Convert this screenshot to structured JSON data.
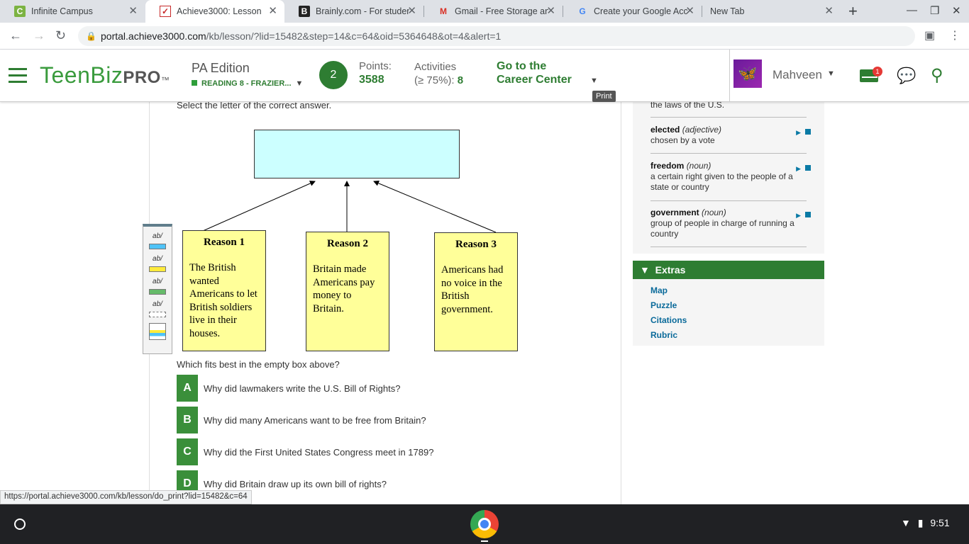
{
  "browser": {
    "tabs": [
      {
        "label": "Infinite Campus",
        "icon": "infinite-campus-icon"
      },
      {
        "label": "Achieve3000: Lesson",
        "icon": "achieve3000-icon"
      },
      {
        "label": "Brainly.com - For studen",
        "icon": "brainly-icon"
      },
      {
        "label": "Gmail - Free Storage and",
        "icon": "gmail-icon"
      },
      {
        "label": "Create your Google Acco",
        "icon": "google-icon"
      },
      {
        "label": "New Tab",
        "icon": ""
      }
    ],
    "url_host": "portal.achieve3000.com",
    "url_path": "/kb/lesson/?lid=15482&step=14&c=64&oid=5364648&ot=4&alert=1"
  },
  "header": {
    "logo_text": "TeenBiz",
    "logo_pro": "PRO",
    "logo_tm": "™",
    "edition": "PA Edition",
    "class_label": "READING 8 - FRAZIER...",
    "level": "2",
    "points_label": "Points:",
    "points_value": "3588",
    "activities_label_1": "Activities",
    "activities_label_2": "(≥ 75%):",
    "activities_value": "8",
    "career_1": "Go to the",
    "career_2": "Career Center",
    "username": "Mahveen",
    "mail_badge": "1",
    "print_tooltip": "Print"
  },
  "lesson": {
    "prompt": "Select the letter of the correct answer.",
    "reasons": [
      {
        "title": "Reason 1",
        "text": "The British wanted Americans to let British soldiers live in their houses."
      },
      {
        "title": "Reason 2",
        "text": "Britain made Americans pay money to Britain."
      },
      {
        "title": "Reason 3",
        "text": "Americans had no voice in the British government."
      }
    ],
    "question": "Which fits best in the empty box above?",
    "answers": [
      {
        "letter": "A",
        "text": "Why did lawmakers write the U.S. Bill of Rights?"
      },
      {
        "letter": "B",
        "text": "Why did many Americans want to be free from Britain?"
      },
      {
        "letter": "C",
        "text": "Why did the First United States Congress meet in 1789?"
      },
      {
        "letter": "D",
        "text": "Why did Britain draw up its own bill of rights?"
      }
    ],
    "highlighter_label": "ab/"
  },
  "sidebar": {
    "partial_def": "the laws of the U.S.",
    "vocab": [
      {
        "word": "elected",
        "pos": "(adjective)",
        "def": "chosen by a vote"
      },
      {
        "word": "freedom",
        "pos": "(noun)",
        "def": "a certain right given to the people of a state or country"
      },
      {
        "word": "government",
        "pos": "(noun)",
        "def": "group of people in charge of running a country"
      }
    ],
    "extras_title": "Extras",
    "extras_links": [
      "Map",
      "Puzzle",
      "Citations",
      "Rubric"
    ]
  },
  "status_url": "https://portal.achieve3000.com/kb/lesson/do_print?lid=15482&c=64",
  "system": {
    "time": "9:51"
  },
  "colors": {
    "brand_green": "#2e7d32",
    "empty_box": "#ccffff",
    "reason_box": "#ffff99",
    "link_blue": "#0a6a9a"
  }
}
